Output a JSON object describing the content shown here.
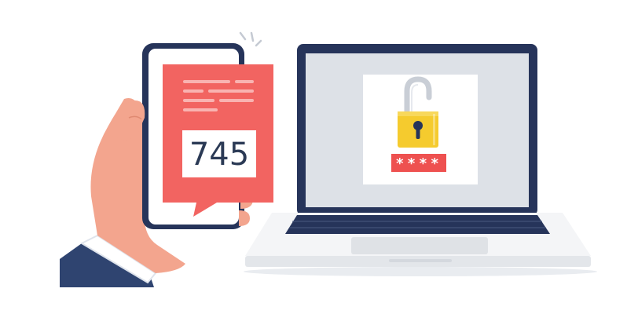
{
  "sms": {
    "code": "745"
  },
  "password": {
    "mask": "****"
  },
  "colors": {
    "message_bubble": "#f26461",
    "lock_body": "#f5cb2e",
    "password_field": "#ee5150",
    "frame_navy": "#26345a",
    "screen_bg": "#dde1e7",
    "skin": "#f3a58e",
    "sleeve": "#2f4470"
  },
  "icons": [
    "smartphone-icon",
    "sms-message-icon",
    "laptop-icon",
    "unlocked-padlock-icon",
    "hand-icon"
  ]
}
